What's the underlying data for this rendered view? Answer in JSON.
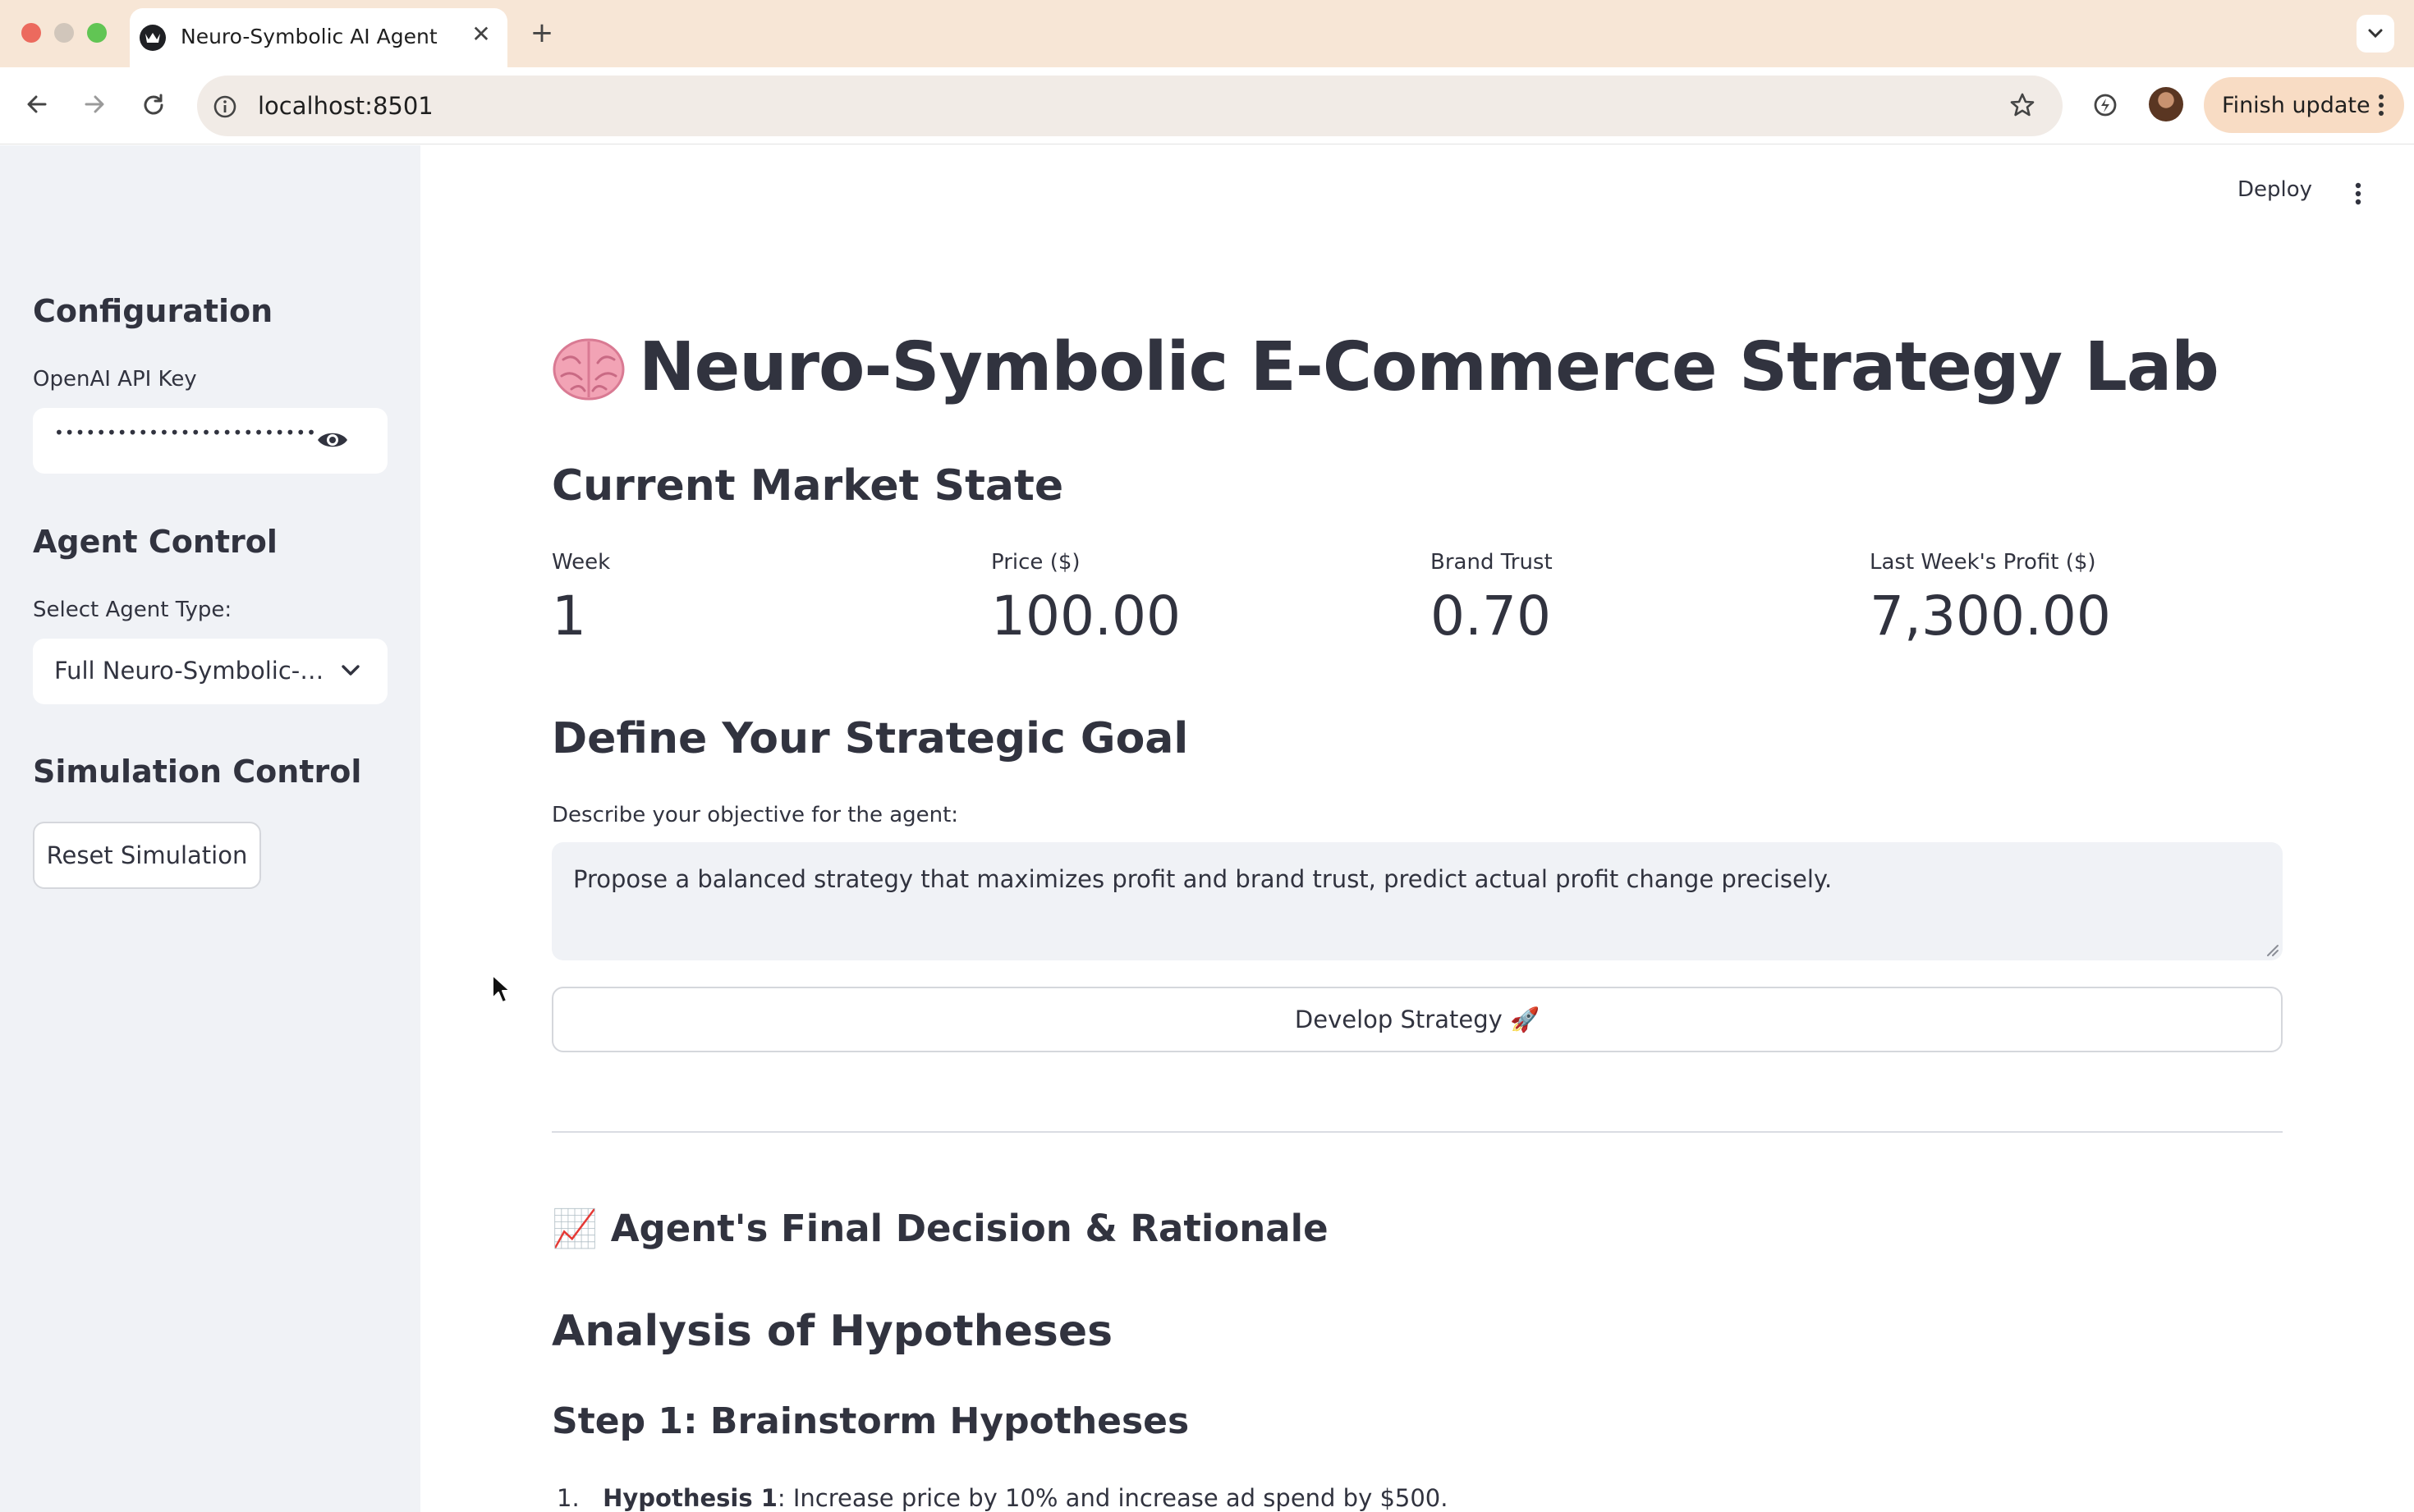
{
  "browser": {
    "tab_title": "Neuro-Symbolic AI Agent",
    "tab_close": "✕",
    "new_tab": "+",
    "url": "localhost:8501",
    "finish_update_label": "Finish update"
  },
  "app_header": {
    "deploy_label": "Deploy"
  },
  "sidebar": {
    "configuration_heading": "Configuration",
    "api_key_label": "OpenAI API Key",
    "api_key_value": "•••••••••••••••••••••••••••••••••••••",
    "agent_control_heading": "Agent Control",
    "agent_type_label": "Select Agent Type:",
    "agent_type_value": "Full Neuro-Symbolic-…",
    "simulation_control_heading": "Simulation Control",
    "reset_button_label": "Reset Simulation"
  },
  "main": {
    "title_emoji": "🧠",
    "title": "Neuro-Symbolic E-Commerce Strategy Lab",
    "market_heading": "Current Market State",
    "metrics": [
      {
        "label": "Week",
        "value": "1"
      },
      {
        "label": "Price ($)",
        "value": "100.00"
      },
      {
        "label": "Brand Trust",
        "value": "0.70"
      },
      {
        "label": "Last Week's Profit ($)",
        "value": "7,300.00"
      }
    ],
    "goal_heading": "Define Your Strategic Goal",
    "goal_label": "Describe your objective for the agent:",
    "goal_text": "Propose a balanced strategy that maximizes profit and brand trust, predict actual profit change precisely.",
    "develop_button_label": "Develop Strategy 🚀",
    "decision_heading": "📈 Agent's Final Decision & Rationale",
    "analysis_heading": "Analysis of Hypotheses",
    "step1_heading": "Step 1: Brainstorm Hypotheses",
    "hypotheses": [
      {
        "number": "1.",
        "label": "Hypothesis 1",
        "text": ": Increase price by 10% and increase ad spend by $500."
      }
    ]
  },
  "icons": {
    "tab_favicon": "streamlit-crown-icon",
    "back": "arrow-left-icon",
    "forward": "arrow-right-icon",
    "reload": "reload-icon",
    "site_info": "info-circle-icon",
    "bookmark": "star-icon",
    "extension": "extension-icon",
    "profile": "avatar",
    "chrome_menu": "vertical-dots-icon",
    "show_password": "eye-icon",
    "dropdown": "chevron-down-icon",
    "app_menu": "vertical-dots-icon",
    "cursor": "mouse-pointer-icon"
  }
}
